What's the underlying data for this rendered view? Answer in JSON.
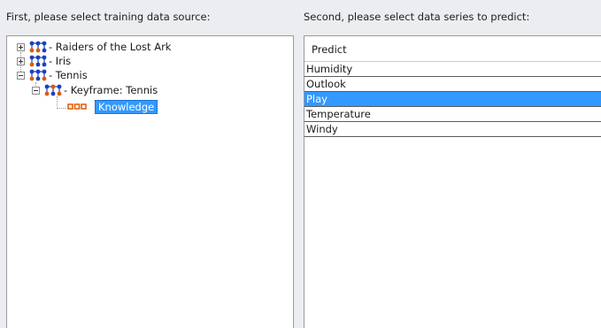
{
  "labels": {
    "source": "First, please select training data source:",
    "series": "Second, please select data series to predict:"
  },
  "tree": {
    "nodes": [
      {
        "label": "- Raiders of the Lost Ark",
        "expander": "plus"
      },
      {
        "label": "- Iris",
        "expander": "plus"
      },
      {
        "label": "- Tennis",
        "expander": "minus"
      },
      {
        "label": "- Keyframe: Tennis",
        "expander": "minus"
      },
      {
        "label": "Knowledge",
        "selected": true
      }
    ]
  },
  "grid": {
    "header": "Predict",
    "rows": [
      "Humidity",
      "Outlook",
      "Play",
      "Temperature",
      "Windy"
    ],
    "selected_row": "Play"
  },
  "colors": {
    "selection": "#3399ff",
    "network_node_blue": "#1a3fbf",
    "network_node_orange": "#e05a00"
  },
  "icons": {
    "tree_node": "network-icon",
    "leaf_node": "knowledge-icon"
  }
}
